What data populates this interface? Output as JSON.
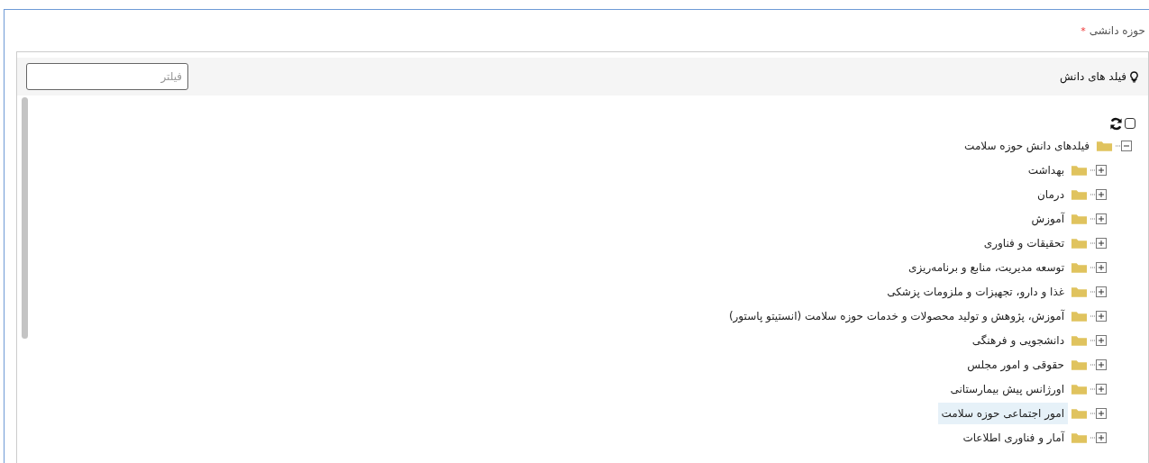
{
  "field": {
    "label": "حوزه دانشی",
    "required_mark": "*"
  },
  "panel": {
    "title": "فیلد های دانش",
    "filter": {
      "placeholder": "فیلتر"
    }
  },
  "tree": {
    "select_all": {
      "checked": false
    },
    "root": {
      "label": "فیلدهای دانش حوزه سلامت",
      "expanded": true,
      "selected": false,
      "children": [
        {
          "label": "بهداشت",
          "expanded": false,
          "selected": false
        },
        {
          "label": "درمان",
          "expanded": false,
          "selected": false
        },
        {
          "label": "آموزش",
          "expanded": false,
          "selected": false
        },
        {
          "label": "تحقیقات و فناوری",
          "expanded": false,
          "selected": false
        },
        {
          "label": "توسعه مدیریت، منابع و برنامه‌ریزی",
          "expanded": false,
          "selected": false
        },
        {
          "label": "غذا و دارو، تجهیزات و ملزومات پزشکی",
          "expanded": false,
          "selected": false
        },
        {
          "label": "آموزش، پژوهش و تولید محصولات و خدمات حوزه سلامت (انستیتو پاستور)",
          "expanded": false,
          "selected": false
        },
        {
          "label": "دانشجویی و فرهنگی",
          "expanded": false,
          "selected": false
        },
        {
          "label": "حقوقی و امور مجلس",
          "expanded": false,
          "selected": false
        },
        {
          "label": "اورژانس پیش بیمارستانی",
          "expanded": false,
          "selected": false
        },
        {
          "label": "امور اجتماعی حوزه سلامت",
          "expanded": false,
          "selected": true
        },
        {
          "label": "آمار و فناوری اطلاعات",
          "expanded": false,
          "selected": false
        }
      ]
    }
  }
}
